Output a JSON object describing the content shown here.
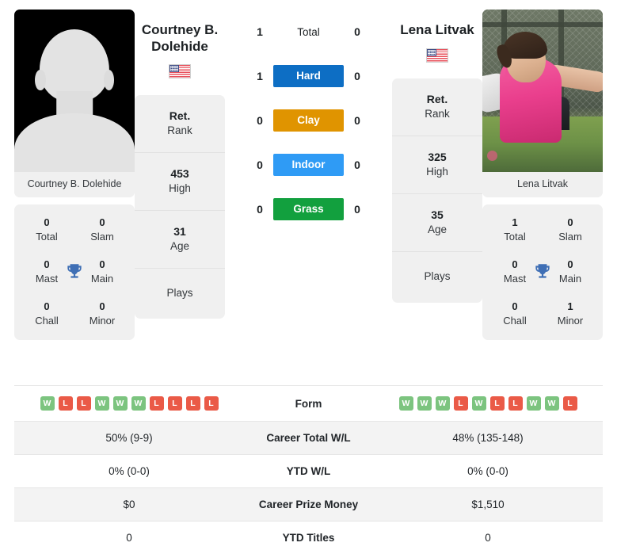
{
  "players": {
    "left": {
      "name": "Courtney B. Dolehide",
      "name_display": "Courtney B.\nDolehide",
      "photo_caption": "Courtney B. Dolehide",
      "photo_type": "silhouette-placeholder",
      "flag": "us-flag-icon",
      "rank": "Ret.",
      "rank_label": "Rank",
      "high": "453",
      "high_label": "High",
      "age": "31",
      "age_label": "Age",
      "plays_label": "Plays",
      "plays_value": "",
      "titles": {
        "total": "0",
        "total_label": "Total",
        "slam": "0",
        "slam_label": "Slam",
        "mast": "0",
        "mast_label": "Mast",
        "main": "0",
        "main_label": "Main",
        "chall": "0",
        "chall_label": "Chall",
        "minor": "0",
        "minor_label": "Minor"
      },
      "form": [
        "W",
        "L",
        "L",
        "W",
        "W",
        "W",
        "L",
        "L",
        "L",
        "L"
      ],
      "career_total_wl": "50% (9-9)",
      "ytd_wl": "0% (0-0)",
      "career_prize_money": "$0",
      "ytd_titles": "0",
      "h2h": {
        "total": "1",
        "hard": "1",
        "clay": "0",
        "indoor": "0",
        "grass": "0"
      }
    },
    "right": {
      "name": "Lena Litvak",
      "name_display": "Lena Litvak",
      "photo_caption": "Lena Litvak",
      "photo_type": "photograph",
      "flag": "us-flag-icon",
      "rank": "Ret.",
      "rank_label": "Rank",
      "high": "325",
      "high_label": "High",
      "age": "35",
      "age_label": "Age",
      "plays_label": "Plays",
      "plays_value": "",
      "titles": {
        "total": "1",
        "total_label": "Total",
        "slam": "0",
        "slam_label": "Slam",
        "mast": "0",
        "mast_label": "Mast",
        "main": "0",
        "main_label": "Main",
        "chall": "0",
        "chall_label": "Chall",
        "minor": "1",
        "minor_label": "Minor"
      },
      "form": [
        "W",
        "W",
        "W",
        "L",
        "W",
        "L",
        "L",
        "W",
        "W",
        "L"
      ],
      "career_total_wl": "48% (135-148)",
      "ytd_wl": "0% (0-0)",
      "career_prize_money": "$1,510",
      "ytd_titles": "0",
      "h2h": {
        "total": "0",
        "hard": "0",
        "clay": "0",
        "indoor": "0",
        "grass": "0"
      }
    }
  },
  "surfaces": [
    {
      "key": "total",
      "label": "Total",
      "badge": false,
      "color": ""
    },
    {
      "key": "hard",
      "label": "Hard",
      "badge": true,
      "color": "#0d6ec4"
    },
    {
      "key": "clay",
      "label": "Clay",
      "badge": true,
      "color": "#e09400"
    },
    {
      "key": "indoor",
      "label": "Indoor",
      "badge": true,
      "color": "#2f9bf5"
    },
    {
      "key": "grass",
      "label": "Grass",
      "badge": true,
      "color": "#12a03e"
    }
  ],
  "table": {
    "rows": [
      {
        "label": "Form",
        "type": "form",
        "left": "",
        "right": ""
      },
      {
        "label": "Career Total W/L",
        "type": "text",
        "left": "50% (9-9)",
        "right": "48% (135-148)"
      },
      {
        "label": "YTD W/L",
        "type": "text",
        "left": "0% (0-0)",
        "right": "0% (0-0)"
      },
      {
        "label": "Career Prize Money",
        "type": "text",
        "left": "$0",
        "right": "$1,510"
      },
      {
        "label": "YTD Titles",
        "type": "text",
        "left": "0",
        "right": "0"
      }
    ]
  },
  "colors": {
    "hard": "#0d6ec4",
    "clay": "#e09400",
    "indoor": "#2f9bf5",
    "grass": "#12a03e",
    "win": "#7cc47f",
    "loss": "#ea5a47",
    "trophy": "#3f6fb5",
    "card_bg": "#f0f0f0",
    "stripe_bg": "#f3f3f3"
  }
}
